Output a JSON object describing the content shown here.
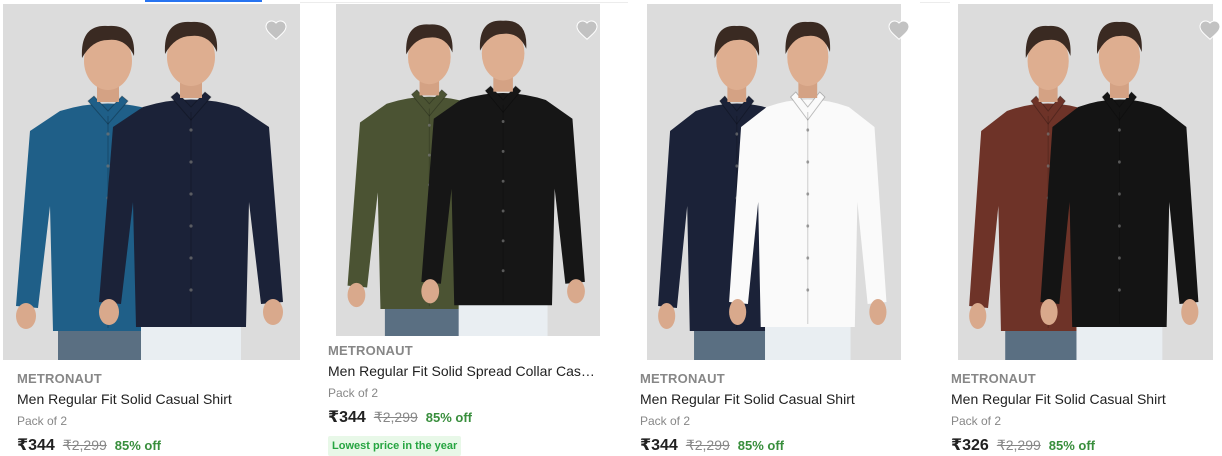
{
  "accent": "#2874f0",
  "products": [
    {
      "brand": "METRONAUT",
      "title": "Men Regular Fit Solid Casual Shirt",
      "pack": "Pack of 2",
      "price": "₹344",
      "mrp": "₹2,299",
      "discount": "85% off",
      "badge": "",
      "colors": [
        "#1f5f88",
        "#1b2238"
      ]
    },
    {
      "brand": "METRONAUT",
      "title": "Men Regular Fit Solid Spread Collar Casual S...",
      "pack": "Pack of 2",
      "price": "₹344",
      "mrp": "₹2,299",
      "discount": "85% off",
      "badge": "Lowest price in the year",
      "colors": [
        "#4b5333",
        "#161616"
      ]
    },
    {
      "brand": "METRONAUT",
      "title": "Men Regular Fit Solid Casual Shirt",
      "pack": "Pack of 2",
      "price": "₹344",
      "mrp": "₹2,299",
      "discount": "85% off",
      "badge": "",
      "colors": [
        "#1b2238",
        "#fafafa"
      ]
    },
    {
      "brand": "METRONAUT",
      "title": "Men Regular Fit Solid Casual Shirt",
      "pack": "Pack of 2",
      "price": "₹326",
      "mrp": "₹2,299",
      "discount": "85% off",
      "badge": "",
      "colors": [
        "#6e3328",
        "#141414"
      ]
    }
  ]
}
